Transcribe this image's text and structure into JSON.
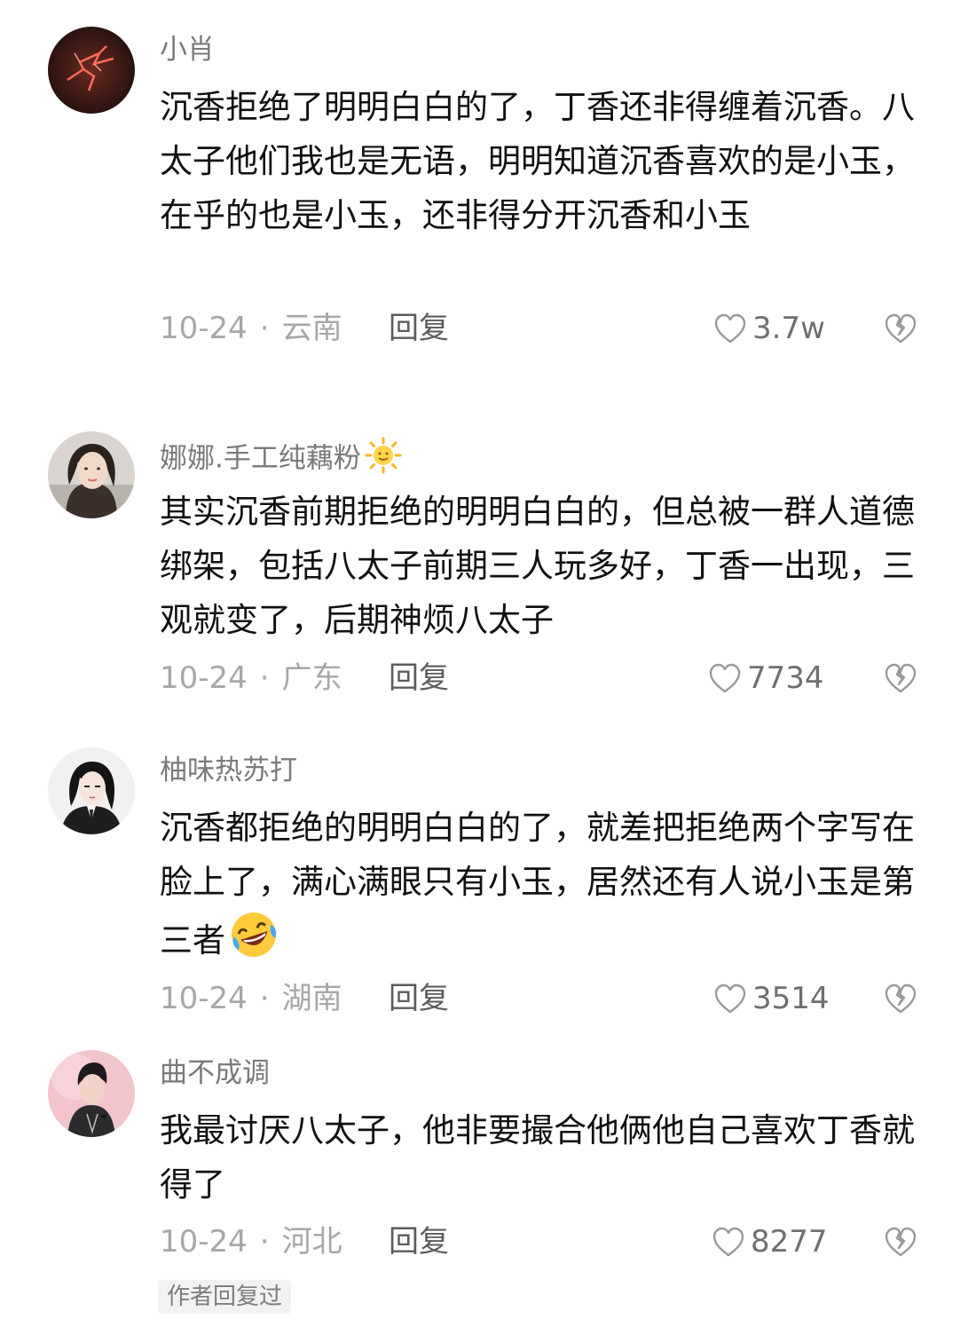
{
  "comments": [
    {
      "username": "小肖",
      "text": "沉香拒绝了明明白白的了，丁香还非得缠着沉香。八太子他们我也是无语，明明知道沉香喜欢的是小玉，在乎的也是小玉，还非得分开沉香和小玉",
      "date": "10-24",
      "location": "云南",
      "reply_label": "回复",
      "likes": "3.7w",
      "avatar_icon": "lightning-avatar"
    },
    {
      "username": "娜娜.手工纯藕粉",
      "username_icon": "sun-emoji",
      "text": "其实沉香前期拒绝的明明白白的，但总被一群人道德绑架，包括八太子前期三人玩多好，丁香一出现，三观就变了，后期神烦八太子",
      "date": "10-24",
      "location": "广东",
      "reply_label": "回复",
      "likes": "7734",
      "avatar_icon": "woman-photo-avatar"
    },
    {
      "username": "柚味热苏打",
      "text": "沉香都拒绝的明明白白的了，就差把拒绝两个字写在脸上了，满心满眼只有小玉，居然还有人说小玉是第三者",
      "text_emoji": "rofl-emoji",
      "date": "10-24",
      "location": "湖南",
      "reply_label": "回复",
      "likes": "3514",
      "avatar_icon": "anime-girl-avatar"
    },
    {
      "username": "曲不成调",
      "text": "我最讨厌八太子，他非要撮合他俩他自己喜欢丁香就得了",
      "date": "10-24",
      "location": "河北",
      "reply_label": "回复",
      "likes": "8277",
      "avatar_icon": "pink-portrait-avatar"
    }
  ],
  "author_replied_label": "作者回复过",
  "colors": {
    "username": "#7a7a7a",
    "body": "#111111",
    "meta": "#a7a7a7",
    "icon": "#b5b5b5"
  }
}
